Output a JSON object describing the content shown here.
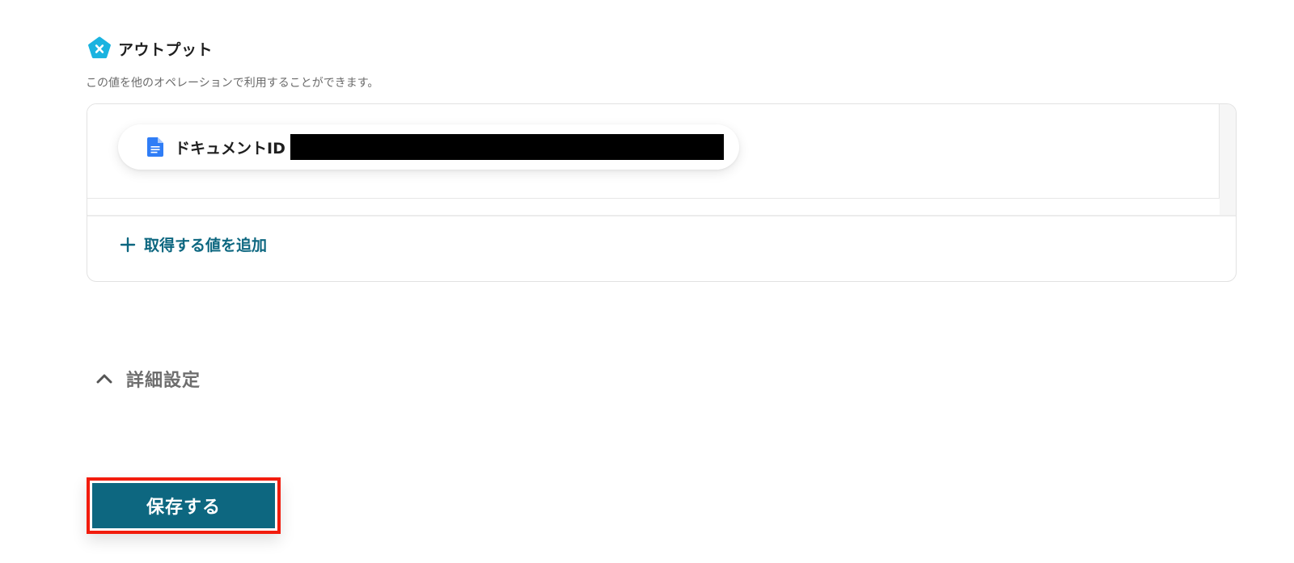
{
  "output_section": {
    "title": "アウトプット",
    "description": "この値を他のオペレーションで利用することができます。",
    "icon": "variable-x-icon",
    "chips": [
      {
        "label": "ドキュメントID",
        "icon": "google-docs-icon",
        "value_redacted": true
      }
    ],
    "add_value_label": "取得する値を追加"
  },
  "details": {
    "label": "詳細設定",
    "expanded": false
  },
  "save": {
    "label": "保存する"
  },
  "colors": {
    "accent": "#0d6780",
    "icon_cyan": "#1ab3e0",
    "docs_blue": "#2f7df6",
    "highlight_red": "#f21c0d"
  }
}
